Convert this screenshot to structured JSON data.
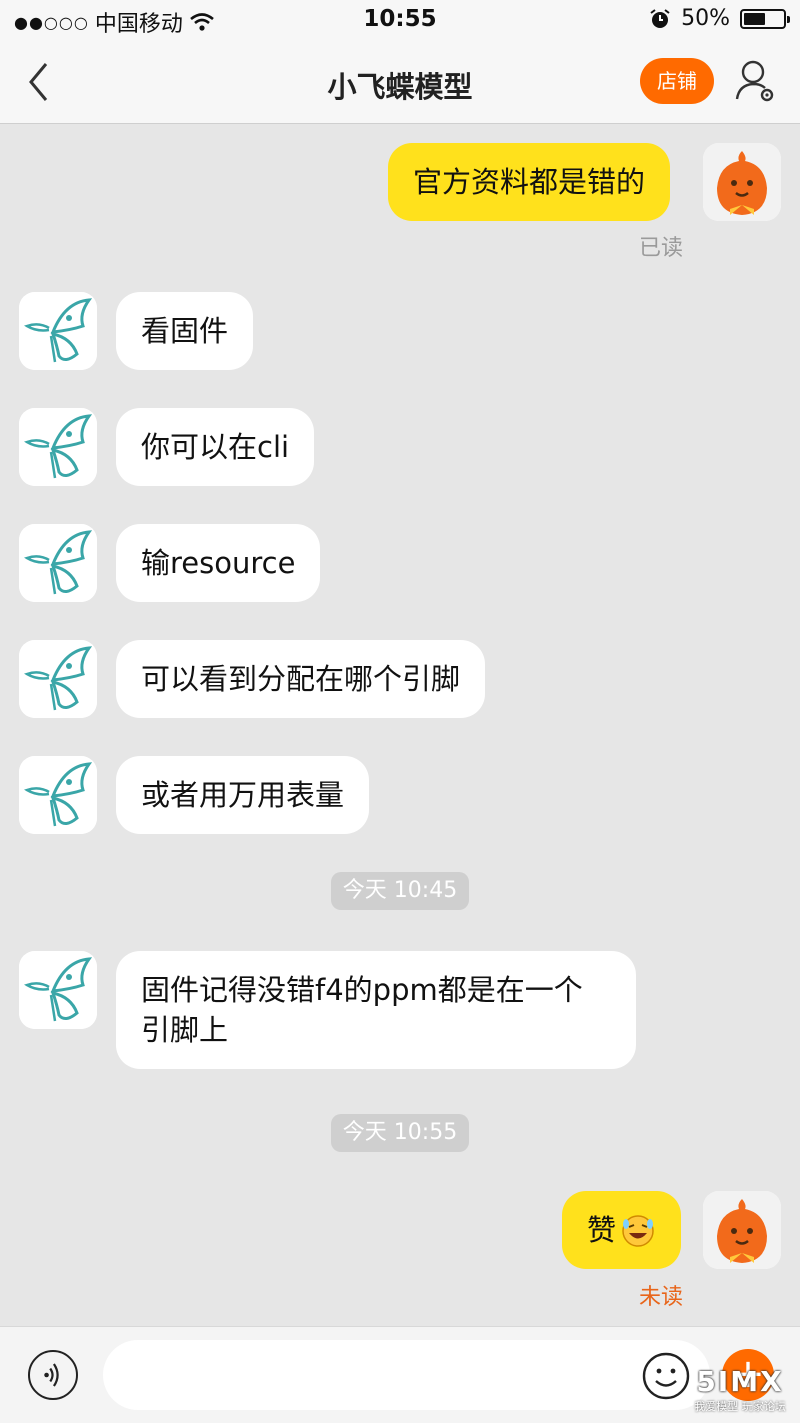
{
  "status": {
    "signal_dots": "●●○○○",
    "carrier": "中国移动",
    "time": "10:55",
    "battery_percent": "50%",
    "battery_level": 0.5
  },
  "nav": {
    "title": "小飞蝶模型",
    "shop_label": "店铺"
  },
  "messages": [
    {
      "from": "self",
      "text": "官方资料都是错的",
      "status": "已读"
    },
    {
      "from": "contact",
      "text": "看固件"
    },
    {
      "from": "contact",
      "text": "你可以在cli"
    },
    {
      "from": "contact",
      "text": "输resource"
    },
    {
      "from": "contact",
      "text": "可以看到分配在哪个引脚"
    },
    {
      "from": "contact",
      "text": "或者用万用表量"
    },
    {
      "timestamp": "今天 10:45"
    },
    {
      "from": "contact",
      "text_lines": [
        "固件记得没错f4的ppm都是在一个",
        "引脚上"
      ]
    },
    {
      "timestamp": "今天 10:55"
    },
    {
      "from": "self",
      "text": "赞",
      "emoji": "laughing-emoji",
      "status": "未读"
    }
  ],
  "input_bar": {
    "placeholder": "",
    "watermark_logo": "5IMX",
    "watermark_text": "我爱模型 玩家论坛"
  },
  "colors": {
    "accent": "#ff6a00",
    "self_bubble": "#ffe11c",
    "background": "#e6e6e6",
    "unread": "#e8651a",
    "read": "#9a9a9a",
    "butterfly": "#3aa6a8"
  }
}
